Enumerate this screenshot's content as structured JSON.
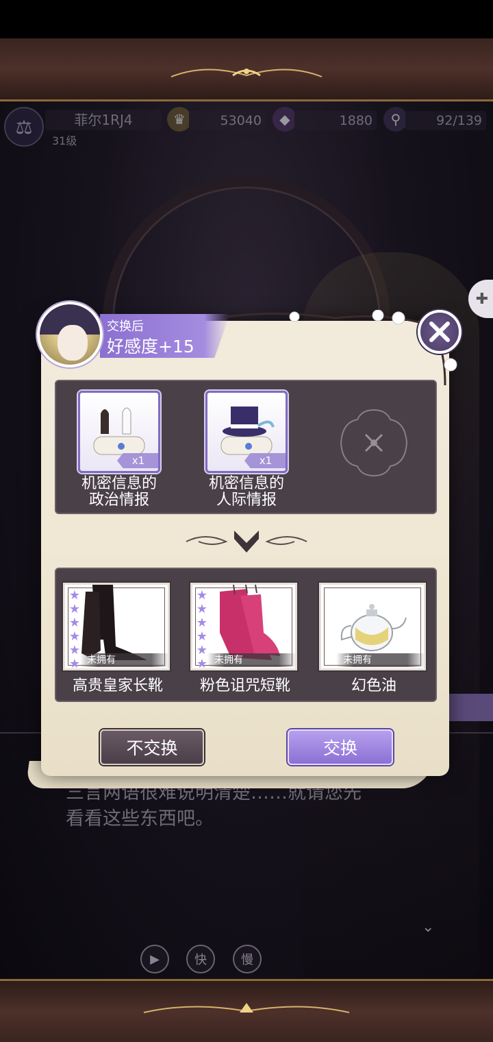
{
  "hud": {
    "player_name": "菲尔1RJ4",
    "level": "31级",
    "gold": "53040",
    "gems": "1880",
    "stamina": "92/139"
  },
  "modal": {
    "affinity_label": "交换后",
    "affinity_value": "好感度+15",
    "give_items": [
      {
        "name_line1": "机密信息的",
        "name_line2": "政治情报",
        "qty": "x1",
        "icon": "chess-scroll-icon"
      },
      {
        "name_line1": "机密信息的",
        "name_line2": "人际情报",
        "qty": "x1",
        "icon": "tophat-scroll-icon"
      }
    ],
    "receive_items": [
      {
        "name": "高贵皇家长靴",
        "status": "未拥有",
        "stars": 6,
        "icon": "black-boots-icon"
      },
      {
        "name": "粉色诅咒短靴",
        "status": "未拥有",
        "stars": 6,
        "icon": "pink-boots-icon"
      },
      {
        "name": "幻色油",
        "status": "未拥有",
        "stars": 0,
        "icon": "teapot-icon"
      }
    ],
    "decline_label": "不交换",
    "accept_label": "交换"
  },
  "dialog": {
    "line1": "三言两语很难说明清楚……就请您先",
    "line2": "看看这些东西吧。"
  },
  "controls": {
    "auto": "▶",
    "fast": "快",
    "slow": "慢"
  },
  "colors": {
    "accent_purple": "#8c70d4",
    "parchment": "#efe6d2",
    "panel": "#4a4048",
    "frame_brown": "#4d302a"
  }
}
